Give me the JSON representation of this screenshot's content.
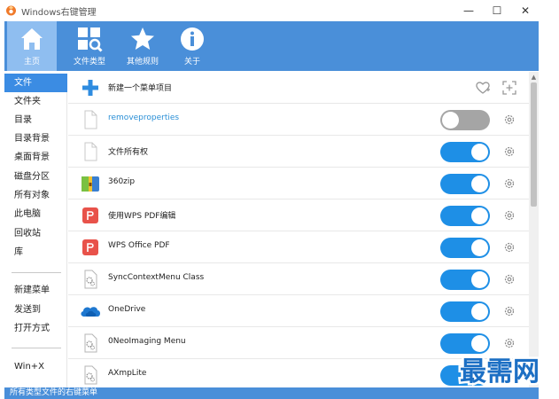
{
  "window": {
    "title": "Windows右键管理",
    "min_glyph": "—",
    "max_glyph": "☐",
    "close_glyph": "✕"
  },
  "topbar": {
    "buttons": [
      {
        "label": "主页",
        "icon": "home-icon",
        "active": true
      },
      {
        "label": "文件类型",
        "icon": "file-type-search-icon",
        "active": false
      },
      {
        "label": "其他规则",
        "icon": "star-icon",
        "active": false
      },
      {
        "label": "关于",
        "icon": "info-icon",
        "active": false
      }
    ]
  },
  "sidebar": {
    "items": [
      {
        "label": "文件",
        "active": true
      },
      {
        "label": "文件夹"
      },
      {
        "label": "目录"
      },
      {
        "label": "目录背景"
      },
      {
        "label": "桌面背景"
      },
      {
        "label": "磁盘分区"
      },
      {
        "label": "所有对象"
      },
      {
        "label": "此电脑"
      },
      {
        "label": "回收站"
      },
      {
        "label": "库"
      }
    ],
    "items2": [
      {
        "label": "新建菜单"
      },
      {
        "label": "发送到"
      },
      {
        "label": "打开方式"
      }
    ],
    "items3": [
      {
        "label": "Win+X"
      }
    ]
  },
  "list": {
    "header_label": "新建一个菜单项目",
    "rows": [
      {
        "label": "removeproperties",
        "icon": "blank-file-icon",
        "enabled": false,
        "link": true
      },
      {
        "label": "文件所有权",
        "icon": "blank-file-icon",
        "enabled": true
      },
      {
        "label": "360zip",
        "icon": "360zip-icon",
        "enabled": true
      },
      {
        "label": "使用WPS PDF编辑",
        "icon": "wps-pdf-icon",
        "enabled": true
      },
      {
        "label": "WPS Office PDF",
        "icon": "wps-pdf-icon",
        "enabled": true
      },
      {
        "label": "SyncContextMenu Class",
        "icon": "settings-file-icon",
        "enabled": true
      },
      {
        "label": "OneDrive",
        "icon": "onedrive-cloud-icon",
        "enabled": true
      },
      {
        "label": "0NeoImaging Menu",
        "icon": "settings-file-icon",
        "enabled": true
      },
      {
        "label": "AXmpLite",
        "icon": "settings-file-icon",
        "enabled": true
      }
    ]
  },
  "statusbar": {
    "text": "所有类型文件的右键菜单"
  },
  "watermark": {
    "text": "最需网"
  },
  "colors": {
    "accent": "#4a8fd9",
    "toggle_on": "#1e8fe6",
    "toggle_off": "#a5a5a5",
    "sidebar_active": "#3b8ce3"
  }
}
